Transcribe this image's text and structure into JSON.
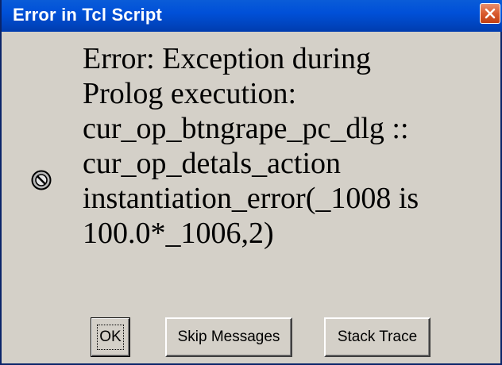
{
  "window": {
    "title": "Error in Tcl Script",
    "close_icon": "close-x-icon"
  },
  "message": {
    "icon": "stop-icon",
    "lines": [
      "Error: Exception during",
      "Prolog execution:",
      "cur_op_btngrape_pc_dlg ::",
      "cur_op_detals_action",
      "instantiation_error(_1008 is",
      "100.0*_1006,2)"
    ]
  },
  "buttons": {
    "ok_label": "OK",
    "skip_label": "Skip Messages",
    "stack_label": "Stack Trace"
  },
  "colors": {
    "titlebar": "#0050d8",
    "close_button": "#d95b2f",
    "dialog_background": "#d4d0c8"
  }
}
